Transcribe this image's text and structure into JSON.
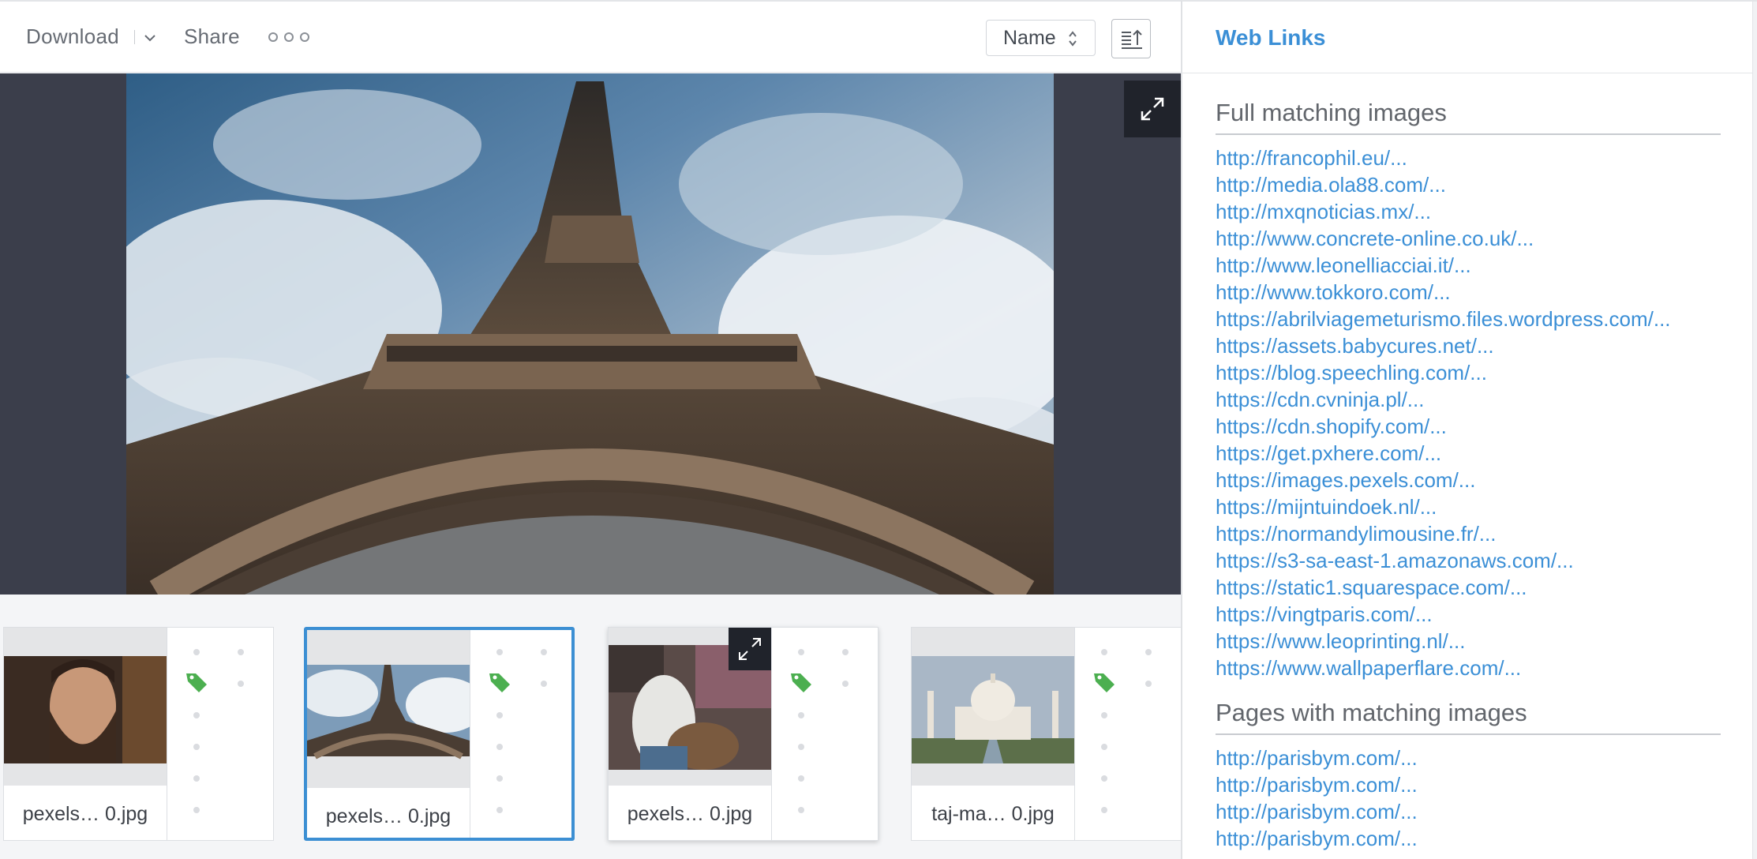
{
  "toolbar": {
    "download_label": "Download",
    "share_label": "Share",
    "sort_value": "Name",
    "icons": {
      "download_menu": "chevron-down-icon",
      "more": "more-options-icon",
      "sort_arrows": "up-down-arrows-icon",
      "sort_direction": "sort-direction-icon"
    }
  },
  "viewer": {
    "image_subject": "Eiffel Tower from below",
    "expand_icon": "expand-icon"
  },
  "thumbnails": [
    {
      "name": "pexels… 0.jpg",
      "selected": false,
      "subject": "bearded man portrait"
    },
    {
      "name": "pexels… 0.jpg",
      "selected": true,
      "subject": "Eiffel Tower"
    },
    {
      "name": "pexels… 0.jpg",
      "selected": false,
      "subject": "man playing drum",
      "show_expand": true
    },
    {
      "name": "taj-ma… 0.jpg",
      "selected": false,
      "subject": "Taj Mahal"
    }
  ],
  "panel": {
    "title": "Web Links",
    "full_matching_heading": "Full matching images",
    "full_matching_links": [
      "http://francophil.eu/...",
      "http://media.ola88.com/...",
      "http://mxqnoticias.mx/...",
      "http://www.concrete-online.co.uk/...",
      "http://www.leonelliacciai.it/...",
      "http://www.tokkoro.com/...",
      "https://abrilviagemeturismo.files.wordpress.com/...",
      "https://assets.babycures.net/...",
      "https://blog.speechling.com/...",
      "https://cdn.cvninja.pl/...",
      "https://cdn.shopify.com/...",
      "https://get.pxhere.com/...",
      "https://images.pexels.com/...",
      "https://mijntuindoek.nl/...",
      "https://normandylimousine.fr/...",
      "https://s3-sa-east-1.amazonaws.com/...",
      "https://static1.squarespace.com/...",
      "https://vingtparis.com/...",
      "https://www.leoprinting.nl/...",
      "https://www.wallpaperflare.com/..."
    ],
    "pages_heading": "Pages with matching images",
    "pages_links": [
      "http://parisbym.com/...",
      "http://parisbym.com/...",
      "http://parisbym.com/...",
      "http://parisbym.com/..."
    ]
  },
  "colors": {
    "accent": "#3b8fd6",
    "viewer_bg": "#3b3e4b",
    "tag_green": "#4caf50",
    "selected_border": "#3c8fd3"
  }
}
